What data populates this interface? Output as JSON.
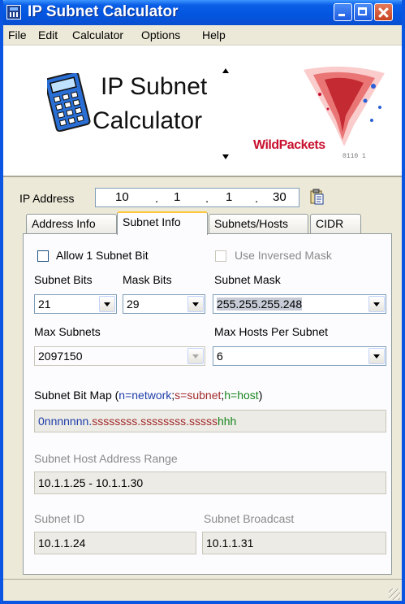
{
  "window": {
    "title": "IP Subnet Calculator"
  },
  "menu": [
    "File",
    "Edit",
    "Calculator",
    "Options",
    "Help"
  ],
  "banner": {
    "line1": "IP Subnet",
    "line2": "Calculator",
    "logo": "WildPackets"
  },
  "ip": {
    "label": "IP Address",
    "octets": [
      "10",
      "1",
      "1",
      "30"
    ]
  },
  "tabs": [
    "Address Info",
    "Subnet Info",
    "Subnets/Hosts",
    "CIDR"
  ],
  "active_tab": "Subnet Info",
  "subnet_info": {
    "allow_1_subnet_bit": {
      "label": "Allow 1 Subnet Bit",
      "checked": false
    },
    "use_inversed_mask": {
      "label": "Use Inversed Mask",
      "checked": false,
      "enabled": false
    },
    "subnet_bits": {
      "label": "Subnet Bits",
      "value": "21"
    },
    "mask_bits": {
      "label": "Mask Bits",
      "value": "29"
    },
    "subnet_mask": {
      "label": "Subnet Mask",
      "value": "255.255.255.248"
    },
    "max_subnets": {
      "label": "Max Subnets",
      "value": "2097150"
    },
    "max_hosts": {
      "label": "Max Hosts Per Subnet",
      "value": "6"
    },
    "bit_map": {
      "label": "Subnet Bit Map (",
      "legend_n": "n=network",
      "sep1": ";",
      "legend_s": "s=subnet",
      "sep2": ";",
      "legend_h": "h=host",
      "close": ")",
      "net_part": "0nnnnnnn.",
      "subnet_part": "ssssssss.ssssssss.sssss",
      "host_part": "hhh"
    },
    "host_range": {
      "label": "Subnet Host Address Range",
      "value": "10.1.1.25 - 10.1.1.30"
    },
    "subnet_id": {
      "label": "Subnet ID",
      "value": "10.1.1.24"
    },
    "broadcast": {
      "label": "Subnet Broadcast",
      "value": "10.1.1.31"
    }
  },
  "colors": {
    "network": "#1f3da8",
    "subnet": "#a22b2b",
    "host": "#18861e"
  }
}
